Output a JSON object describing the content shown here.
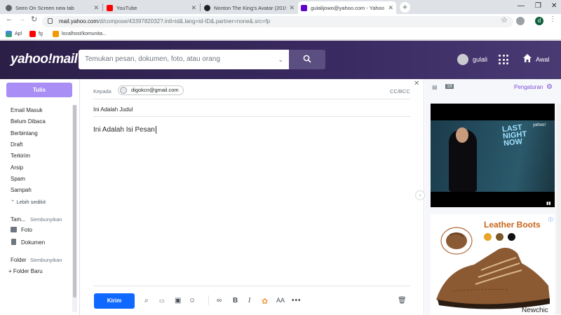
{
  "browser": {
    "tabs": [
      {
        "title": "Seen On Screen new tab",
        "icon": "globe-icon"
      },
      {
        "title": "YouTube",
        "icon": "youtube-icon"
      },
      {
        "title": "Nonton The King's Avatar (2019) ...",
        "icon": "site-icon"
      },
      {
        "title": "gulalijowo@yahoo.com - Yahoo Ma...",
        "icon": "yahoo-mail-icon"
      }
    ],
    "url_host": "mail.yahoo.com",
    "url_path": "/d/compose/4339782032?.intl=id&.lang=id-ID&.partner=none&.src=fp",
    "profile_initial": "d",
    "bookmarks": [
      {
        "label": "Apl",
        "icon": "apps-icon"
      },
      {
        "label": "fg",
        "icon": "youtube-icon"
      },
      {
        "label": "localhost/komunita...",
        "icon": "folder-icon"
      }
    ]
  },
  "header": {
    "logo": "yahoo!mail",
    "search_placeholder": "Temukan pesan, dokumen, foto, atau orang",
    "username": "gulali",
    "home_label": "Awal"
  },
  "sidebar": {
    "compose_label": "Tulis",
    "folders": [
      "Email Masuk",
      "Belum Dibaca",
      "Berbintang",
      "Draft",
      "Terkirim",
      "Arsip",
      "Spam",
      "Sampah"
    ],
    "less_label": "Lebih sedikit",
    "views_label": "Tam...",
    "views_hide": "Sembunyikan",
    "photos_label": "Foto",
    "docs_label": "Dokumen",
    "folder_label": "Folder",
    "folder_hide": "Sembunyikan",
    "new_folder": "+ Folder Baru"
  },
  "compose": {
    "to_label": "Kepada",
    "recipient": "digokcn@gmail.com",
    "cc_label": "CC/BCC",
    "subject": "Ini Adalah Judul",
    "body": "Ini Adalah Isi Pesan",
    "send_label": "Kirim"
  },
  "right_panel": {
    "settings_label": "Pengaturan",
    "video": {
      "title_lines": "LAST NIGHT NOW",
      "brand": "yahoo!"
    },
    "ad": {
      "title": "Leather Boots",
      "brand": "Newchic",
      "swatches": [
        "#e7a526",
        "#7a5a2a",
        "#111111"
      ]
    }
  },
  "colors": {
    "accent": "#7d4cdb",
    "send": "#0f69ff",
    "compose": "#a98ef5",
    "header": "#3a2a62"
  }
}
